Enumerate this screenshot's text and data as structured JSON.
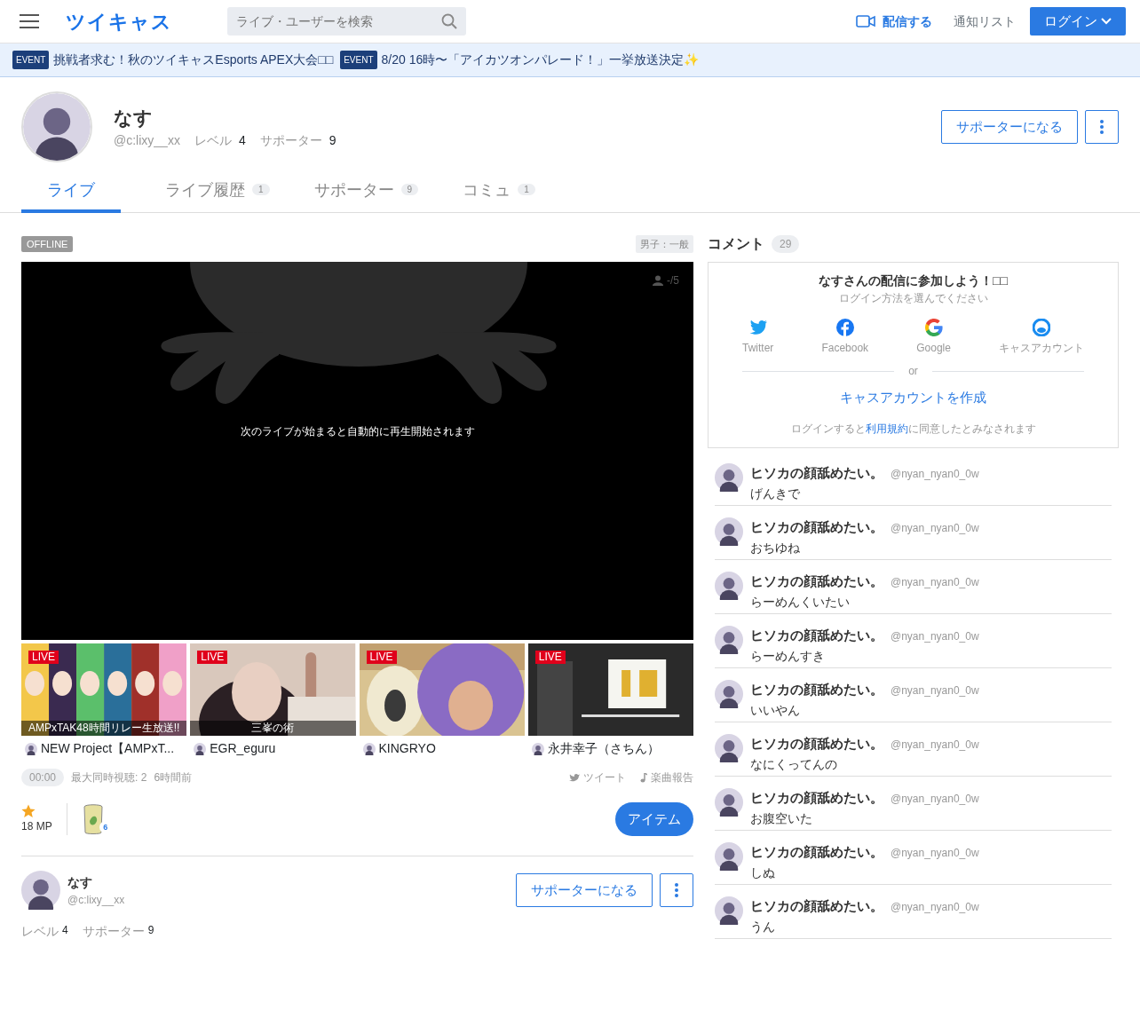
{
  "header": {
    "logo": "ツイキャス",
    "search_placeholder": "ライブ・ユーザーを検索",
    "broadcast": "配信する",
    "notifications": "通知リスト",
    "login": "ログイン"
  },
  "events": [
    {
      "badge": "EVENT",
      "text": "挑戦者求む！秋のツイキャスEsports APEX大会□□"
    },
    {
      "badge": "EVENT",
      "text": "8/20 16時〜「アイカツオンパレード！」一挙放送決定✨"
    }
  ],
  "profile": {
    "name": "なす",
    "handle": "@c:lixy__xx",
    "level_label": "レベル",
    "level": "4",
    "supporters_label": "サポーター",
    "supporters": "9",
    "support_button": "サポーターになる"
  },
  "tabs": [
    {
      "label": "ライブ",
      "selected": true
    },
    {
      "label": "ライブ履歴",
      "count": "1",
      "selected": false
    },
    {
      "label": "サポーター",
      "count": "9",
      "selected": false
    },
    {
      "label": "コミュ",
      "count": "1",
      "selected": false
    }
  ],
  "live": {
    "status": "OFFLINE",
    "category": "男子：一般",
    "viewers": "-/5",
    "message": "次のライブが始まると自動的に再生開始されます"
  },
  "recommendations": [
    {
      "badge": "LIVE",
      "caption": "AMPxTAK48時間リレー生放送!!",
      "channel": "NEW Project【AMPxT..."
    },
    {
      "badge": "LIVE",
      "caption": "三峯の術",
      "channel": "EGR_eguru"
    },
    {
      "badge": "LIVE",
      "channel": "KINGRYO"
    },
    {
      "badge": "LIVE",
      "channel": "永井幸子（さちん）"
    }
  ],
  "stats": {
    "duration": "00:00",
    "max_viewers": "最大同時視聴: 2",
    "ago": "6時間前",
    "tweet": "ツイート",
    "song_report": "楽曲報告"
  },
  "items": {
    "mp": "18 MP",
    "item_count": "6",
    "item_button": "アイテム"
  },
  "owner": {
    "name": "なす",
    "handle": "@c:lixy__xx",
    "level_label": "レベル",
    "level": "4",
    "supporters_label": "サポーター",
    "supporters": "9",
    "support_button": "サポーターになる"
  },
  "comments": {
    "title": "コメント",
    "count": "29",
    "login_card": {
      "title": "なすさんの配信に参加しよう！□□",
      "subtitle": "ログイン方法を選んでください",
      "providers": [
        {
          "kind": "twitter",
          "label": "Twitter"
        },
        {
          "kind": "facebook",
          "label": "Facebook"
        },
        {
          "kind": "google",
          "label": "Google"
        },
        {
          "kind": "cas",
          "label": "キャスアカウント"
        }
      ],
      "or": "or",
      "create": "キャスアカウントを作成",
      "terms_before": "ログインすると",
      "terms_link": "利用規約",
      "terms_after": "に同意したとみなされます"
    },
    "list": [
      {
        "name": "ヒソカの顔舐めたい。",
        "handle": "@nyan_nyan0_0w",
        "text": "げんきで"
      },
      {
        "name": "ヒソカの顔舐めたい。",
        "handle": "@nyan_nyan0_0w",
        "text": "おちゆね"
      },
      {
        "name": "ヒソカの顔舐めたい。",
        "handle": "@nyan_nyan0_0w",
        "text": "らーめんくいたい"
      },
      {
        "name": "ヒソカの顔舐めたい。",
        "handle": "@nyan_nyan0_0w",
        "text": "らーめんすき"
      },
      {
        "name": "ヒソカの顔舐めたい。",
        "handle": "@nyan_nyan0_0w",
        "text": "いいやん"
      },
      {
        "name": "ヒソカの顔舐めたい。",
        "handle": "@nyan_nyan0_0w",
        "text": "なにくってんの"
      },
      {
        "name": "ヒソカの顔舐めたい。",
        "handle": "@nyan_nyan0_0w",
        "text": "お腹空いた"
      },
      {
        "name": "ヒソカの顔舐めたい。",
        "handle": "@nyan_nyan0_0w",
        "text": "しぬ"
      },
      {
        "name": "ヒソカの顔舐めたい。",
        "handle": "@nyan_nyan0_0w",
        "text": "うん"
      }
    ]
  }
}
